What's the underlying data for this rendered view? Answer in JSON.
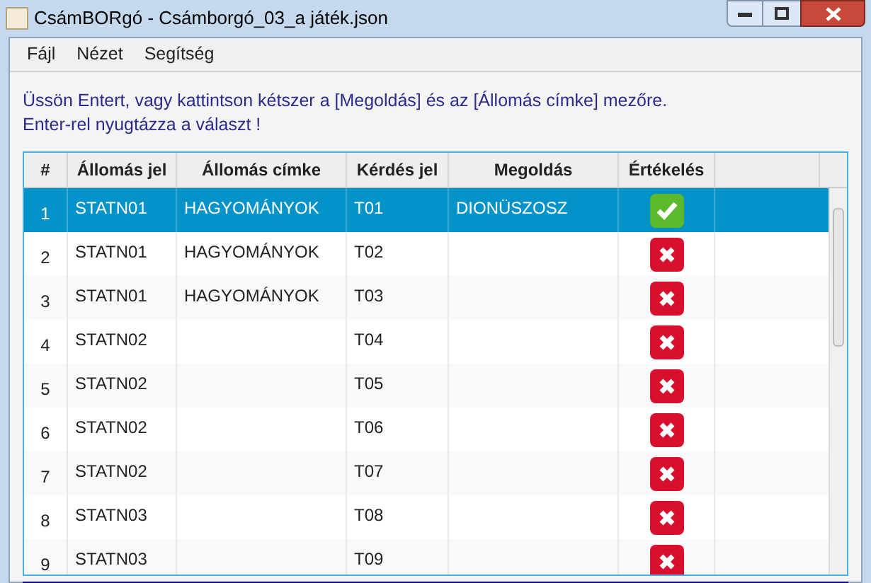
{
  "window": {
    "title": "CsámBORgó - Csámborgó_03_a játék.json"
  },
  "menu": [
    "Fájl",
    "Nézet",
    "Segítség"
  ],
  "instructions": [
    "Üssön Entert, vagy kattintson kétszer a [Megoldás] és az [Állomás címke] mezőre.",
    "Enter-rel nyugtázza a választ !"
  ],
  "table": {
    "columns": [
      "#",
      "Állomás jel",
      "Állomás címke",
      "Kérdés jel",
      "Megoldás",
      "Értékelés"
    ],
    "rows": [
      {
        "num": "1",
        "station": "STATN01",
        "label": "HAGYOMÁNYOK",
        "question": "T01",
        "answer": "DIONÜSZOSZ",
        "correct": true,
        "selected": true
      },
      {
        "num": "2",
        "station": "STATN01",
        "label": "HAGYOMÁNYOK",
        "question": "T02",
        "correct": false,
        "selected": false
      },
      {
        "num": "3",
        "station": "STATN01",
        "label": "HAGYOMÁNYOK",
        "question": "T03",
        "correct": false,
        "selected": false
      },
      {
        "num": "4",
        "station": "STATN02",
        "question": "T04",
        "correct": false,
        "selected": false
      },
      {
        "num": "5",
        "station": "STATN02",
        "question": "T05",
        "correct": false,
        "selected": false
      },
      {
        "num": "6",
        "station": "STATN02",
        "question": "T06",
        "correct": false,
        "selected": false
      },
      {
        "num": "7",
        "station": "STATN02",
        "question": "T07",
        "correct": false,
        "selected": false
      },
      {
        "num": "8",
        "station": "STATN03",
        "question": "T08",
        "correct": false,
        "selected": false
      },
      {
        "num": "9",
        "station": "STATN03",
        "question": "T09",
        "correct": false,
        "selected": false
      }
    ]
  }
}
